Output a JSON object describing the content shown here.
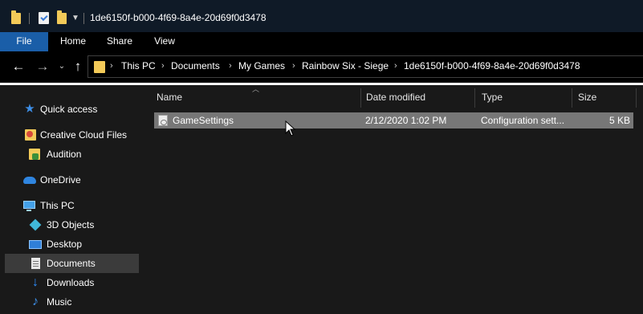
{
  "window": {
    "title": "1de6150f-b000-4f69-8a4e-20d69f0d3478"
  },
  "ribbon": {
    "tabs": [
      "File",
      "Home",
      "Share",
      "View"
    ]
  },
  "nav_buttons": {
    "back_icon": "back-arrow-icon",
    "forward_icon": "forward-arrow-icon",
    "recent_icon": "chevron-down-icon",
    "up_icon": "up-arrow-icon"
  },
  "breadcrumb": {
    "items": [
      "This PC",
      "Documents",
      "My Games",
      "Rainbow Six - Siege",
      "1de6150f-b000-4f69-8a4e-20d69f0d3478"
    ]
  },
  "navpane": {
    "items": [
      {
        "label": "Quick access",
        "icon": "star-icon"
      },
      {
        "label": "Creative Cloud Files",
        "icon": "creative-cloud-folder-icon"
      },
      {
        "label": "Audition",
        "icon": "audition-folder-icon"
      },
      {
        "label": "OneDrive",
        "icon": "cloud-icon"
      },
      {
        "label": "This PC",
        "icon": "computer-icon"
      },
      {
        "label": "3D Objects",
        "icon": "cube-icon"
      },
      {
        "label": "Desktop",
        "icon": "desktop-icon"
      },
      {
        "label": "Documents",
        "icon": "document-icon"
      },
      {
        "label": "Downloads",
        "icon": "download-icon"
      },
      {
        "label": "Music",
        "icon": "music-note-icon"
      }
    ],
    "selected": "Documents"
  },
  "columns": [
    "Name",
    "Date modified",
    "Type",
    "Size"
  ],
  "files": [
    {
      "name": "GameSettings",
      "date_modified": "2/12/2020 1:02 PM",
      "type": "Configuration sett...",
      "size": "5 KB",
      "icon": "config-file-icon"
    }
  ],
  "colors": {
    "accent": "#1a5ea8",
    "folder": "#f3ca58",
    "selection": "#777777",
    "nav_selected": "#3b3b3b"
  }
}
